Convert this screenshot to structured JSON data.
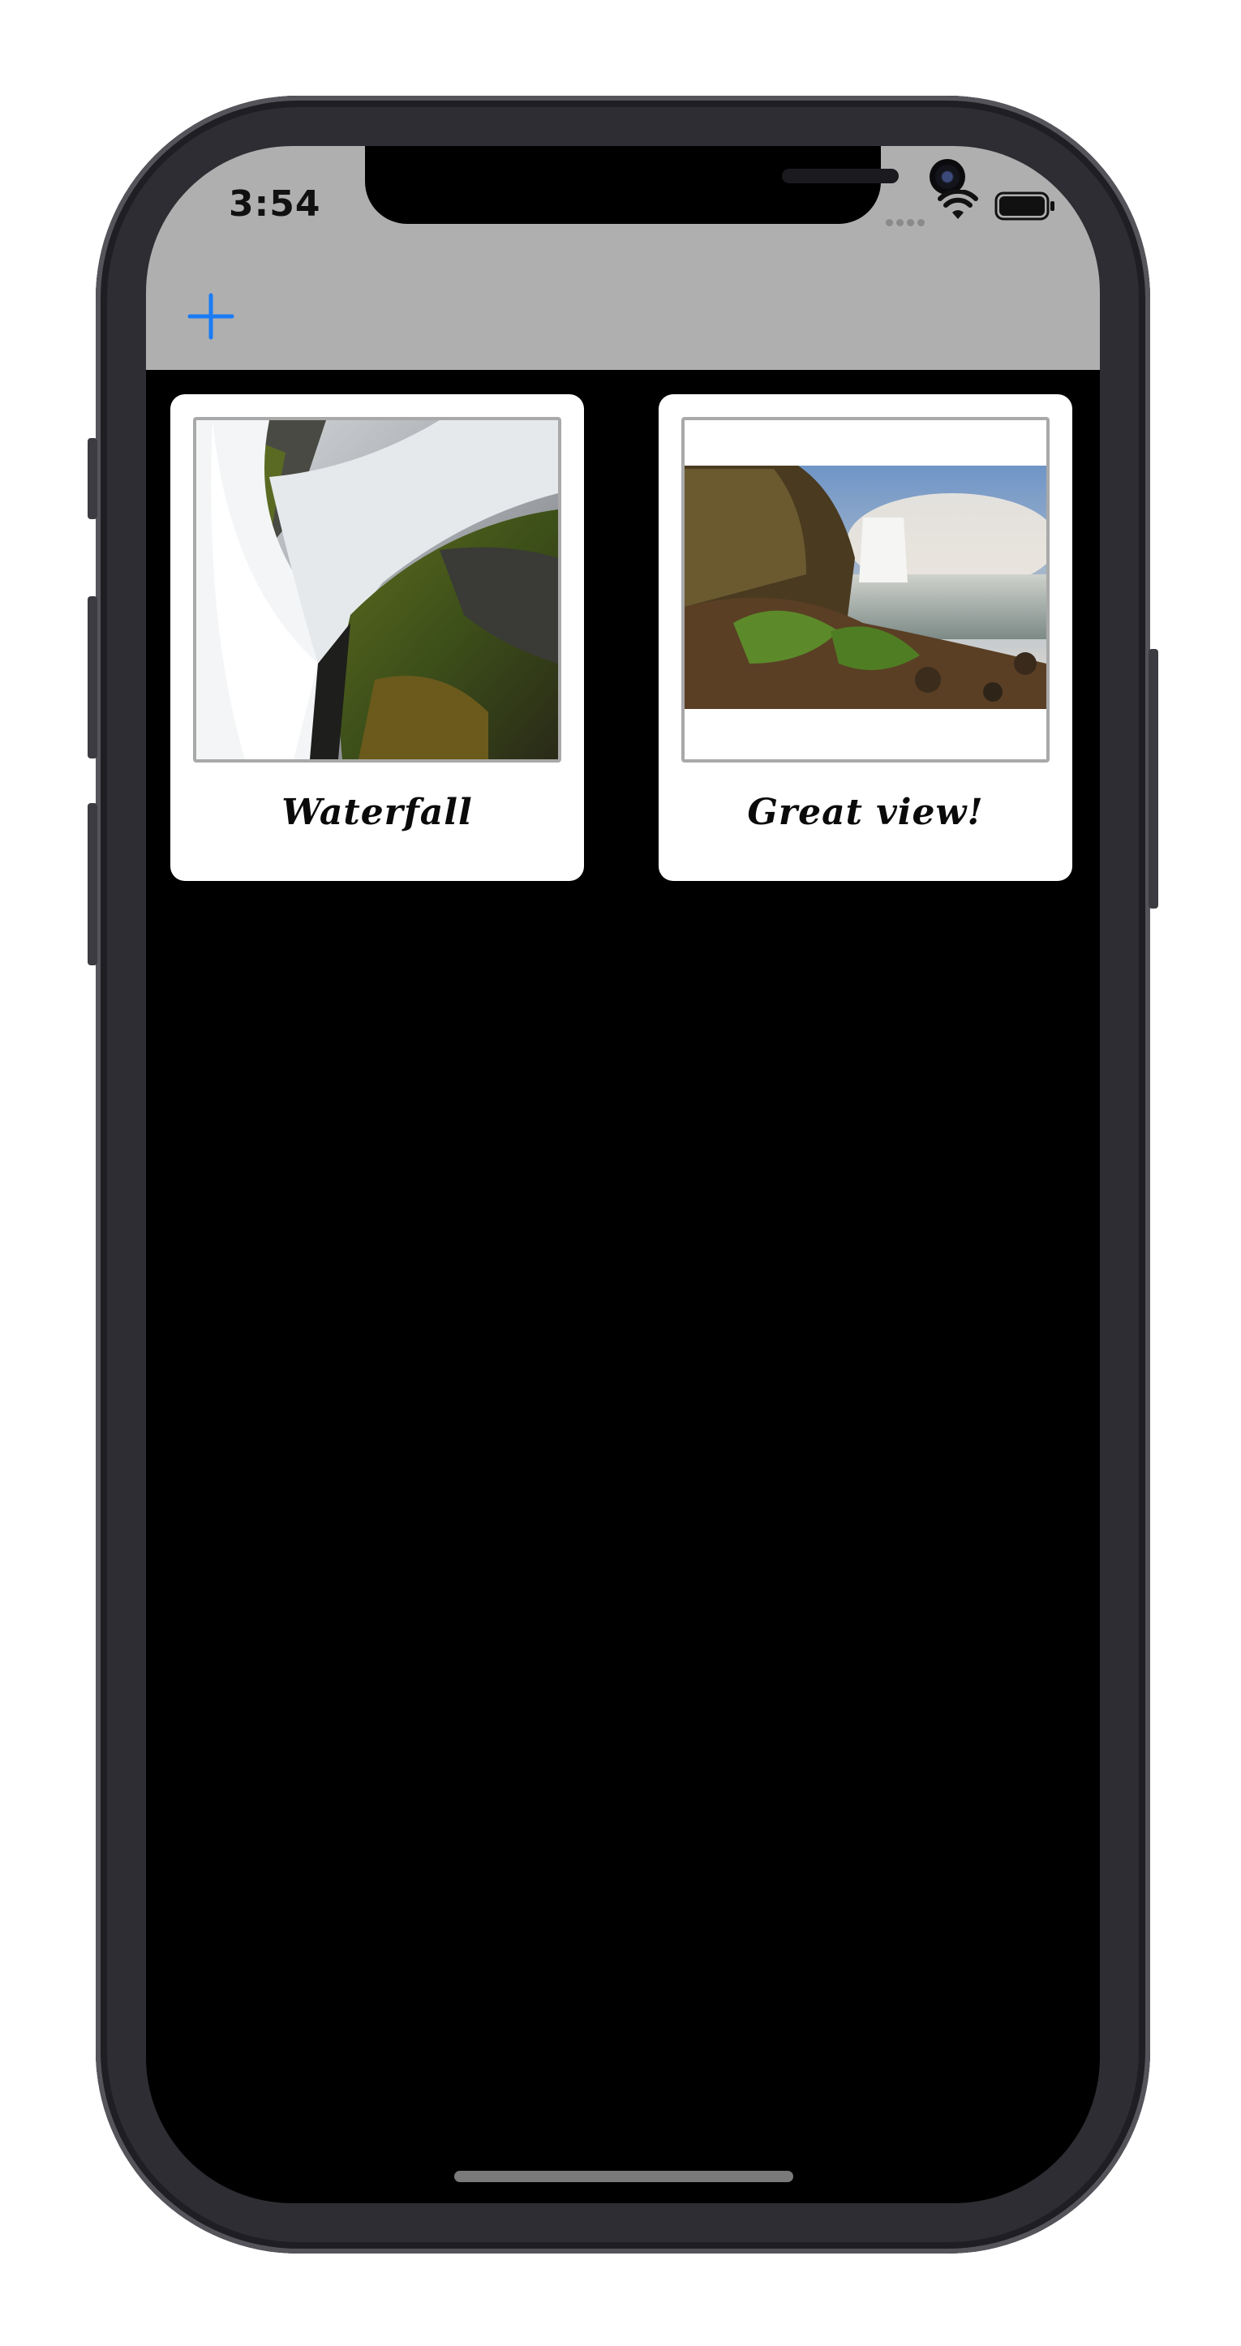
{
  "status_bar": {
    "time": "3:54",
    "icons": [
      "signal-dots-icon",
      "wifi-icon",
      "battery-icon"
    ]
  },
  "nav_bar": {
    "add_icon": "plus-icon",
    "accent_color": "#1a7cf5",
    "background_color": "#afafaf"
  },
  "cards": [
    {
      "caption": "Waterfall",
      "image": "waterfall close-up photo"
    },
    {
      "caption": "Great view!",
      "image": "waterfall landscape photo"
    }
  ],
  "colors": {
    "screen_background": "#000000",
    "card_background": "#ffffff",
    "photo_border": "#a9a9a9"
  }
}
